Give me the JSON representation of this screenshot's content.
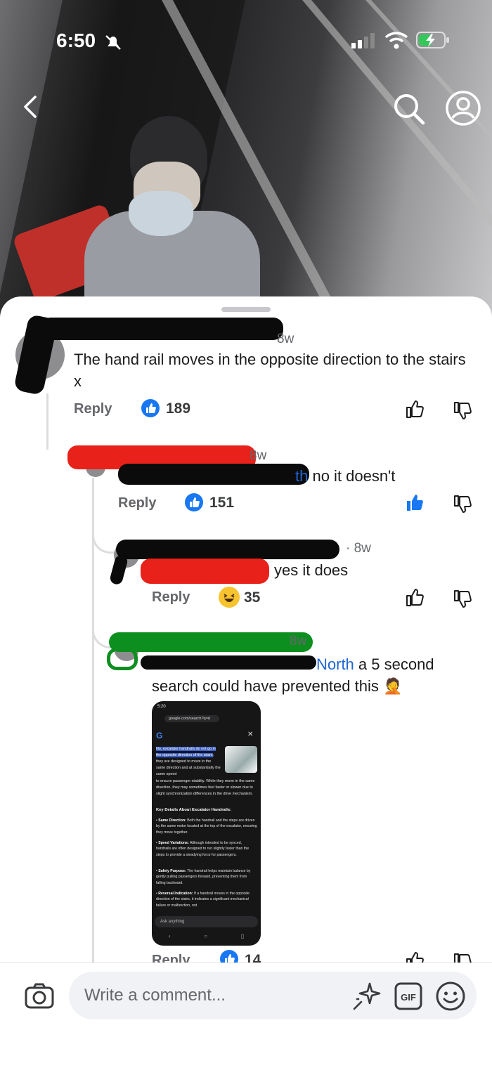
{
  "status_bar": {
    "time": "6:50"
  },
  "comments": [
    {
      "meta": "8w",
      "text": "The hand rail moves in the opposite direction to the stairs x",
      "reply_label": "Reply",
      "like_count": "189"
    },
    {
      "meta": "8w",
      "mention_tail": "th",
      "text": " no it doesn't",
      "reply_label": "Reply",
      "like_count": "151"
    },
    {
      "meta": "· 8w",
      "text": "yes it does",
      "reply_label": "Reply",
      "like_count": "35"
    },
    {
      "meta": "8w",
      "mention_tail": "North",
      "text_line1": " a 5 second",
      "text_line2": "search could have prevented this",
      "emoji": "🤦",
      "reply_label": "Reply",
      "like_count": "14"
    }
  ],
  "embedded_screenshot": {
    "status": "5:20",
    "url": "google.com/search?q=d",
    "highlight": "No, escalator handrails do not go in the opposite direction of the stairs",
    "paragraph": "; they are designed to move in the same direction and at substantially the same speed",
    "paragraph2": "to ensure passenger stability. While they move in the same direction, they may sometimes feel faster or slower due to slight synchronization differences in the drive mechanism.",
    "heading": "Key Details About Escalator Handrails:",
    "bullets": [
      {
        "title": "Same Direction:",
        "body": " Both the handrail and the steps are driven by the same motor located at the top of the escalator, ensuring they move together."
      },
      {
        "title": "Speed Variations:",
        "body": " Although intended to be synced, handrails are often designed to run slightly faster than the steps to provide a steadying force for passengers."
      },
      {
        "title": "Safety Purpose:",
        "body": " The handrail helps maintain balance by gently pulling passengers forward, preventing them from falling backward."
      },
      {
        "title": "Reversal Indication:",
        "body": " If a handrail moves in the opposite direction of the stairs, it indicates a significant mechanical failure or malfunction, not"
      }
    ],
    "ask_placeholder": "Ask anything"
  },
  "composer": {
    "placeholder": "Write a comment..."
  },
  "colors": {
    "like_blue": "#1877f2",
    "mention_blue": "#1f66d4"
  }
}
